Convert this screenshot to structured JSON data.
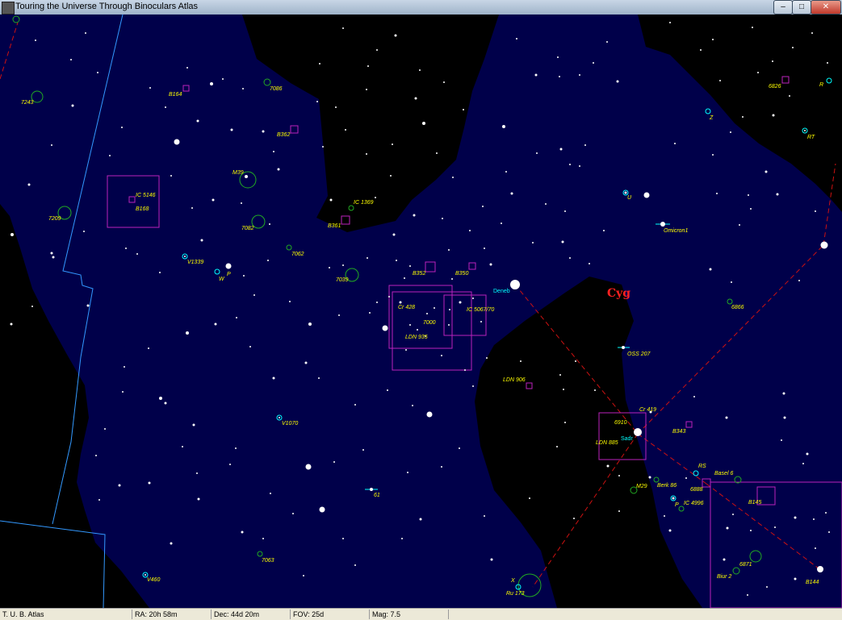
{
  "window": {
    "title": "Touring the Universe Through Binoculars Atlas",
    "buttons": {
      "minimize": "–",
      "maximize": "□",
      "close": "✕"
    }
  },
  "colors": {
    "sky": "#000033",
    "milky_way": "#00004a",
    "dark": "#000000",
    "object_label": "#ffff00",
    "star_label": "#00ffff",
    "constellation_lines": "#cc1111",
    "boundary": "#3399ff",
    "field_boxes": "#bb22bb",
    "open_clusters": "#22aa22"
  },
  "map": {
    "constellation": "Cyg",
    "star_labels": {
      "deneb": "Deneb",
      "sadr": "Sadr"
    },
    "object_labels": {
      "n7243": "7243",
      "b164": "B164",
      "n7086": "7086",
      "n6826": "6826",
      "r": "R",
      "b362": "B362",
      "z": "Z",
      "rt": "RT",
      "m39": "M39",
      "ic5146": "IC 5146",
      "b168": "B168",
      "ic1369": "IC 1369",
      "u": "U",
      "n7209": "7209",
      "n7082": "7082",
      "b361": "B361",
      "omicron1": "Omicron1",
      "v1339": "V1339",
      "n7062": "7062",
      "w": "W",
      "p_star": "P",
      "n7039": "7039",
      "b352": "B352",
      "b350": "B350",
      "cr428": "Cr 428",
      "ic5067": "IC 5067/70",
      "n7000": "7000",
      "ldn935": "LDN 935",
      "n6866": "6866",
      "oss207": "OSS 207",
      "ldn906": "LDN 906",
      "v1070": "V1070",
      "n6910": "6910",
      "cr419": "Cr 419",
      "ldn885": "LDN 885",
      "b343": "B343",
      "rs": "RS",
      "basel6": "Basel 6",
      "n6888": "6888",
      "m29": "M29",
      "berk86": "Berk 86",
      "ic4996": "IC 4996",
      "p_cyg": "P",
      "b145": "B145",
      "n61": "61",
      "n7063": "7063",
      "v460": "V460",
      "x": "X",
      "ru173": "Ru 173",
      "n6871": "6871",
      "biur2": "Biur 2",
      "b144": "B144"
    }
  },
  "statusbar": {
    "app": "T. U. B. Atlas",
    "ra": "RA: 20h 58m",
    "dec": "Dec: 44d 20m",
    "fov": "FOV: 25d",
    "mag": "Mag: 7.5"
  }
}
